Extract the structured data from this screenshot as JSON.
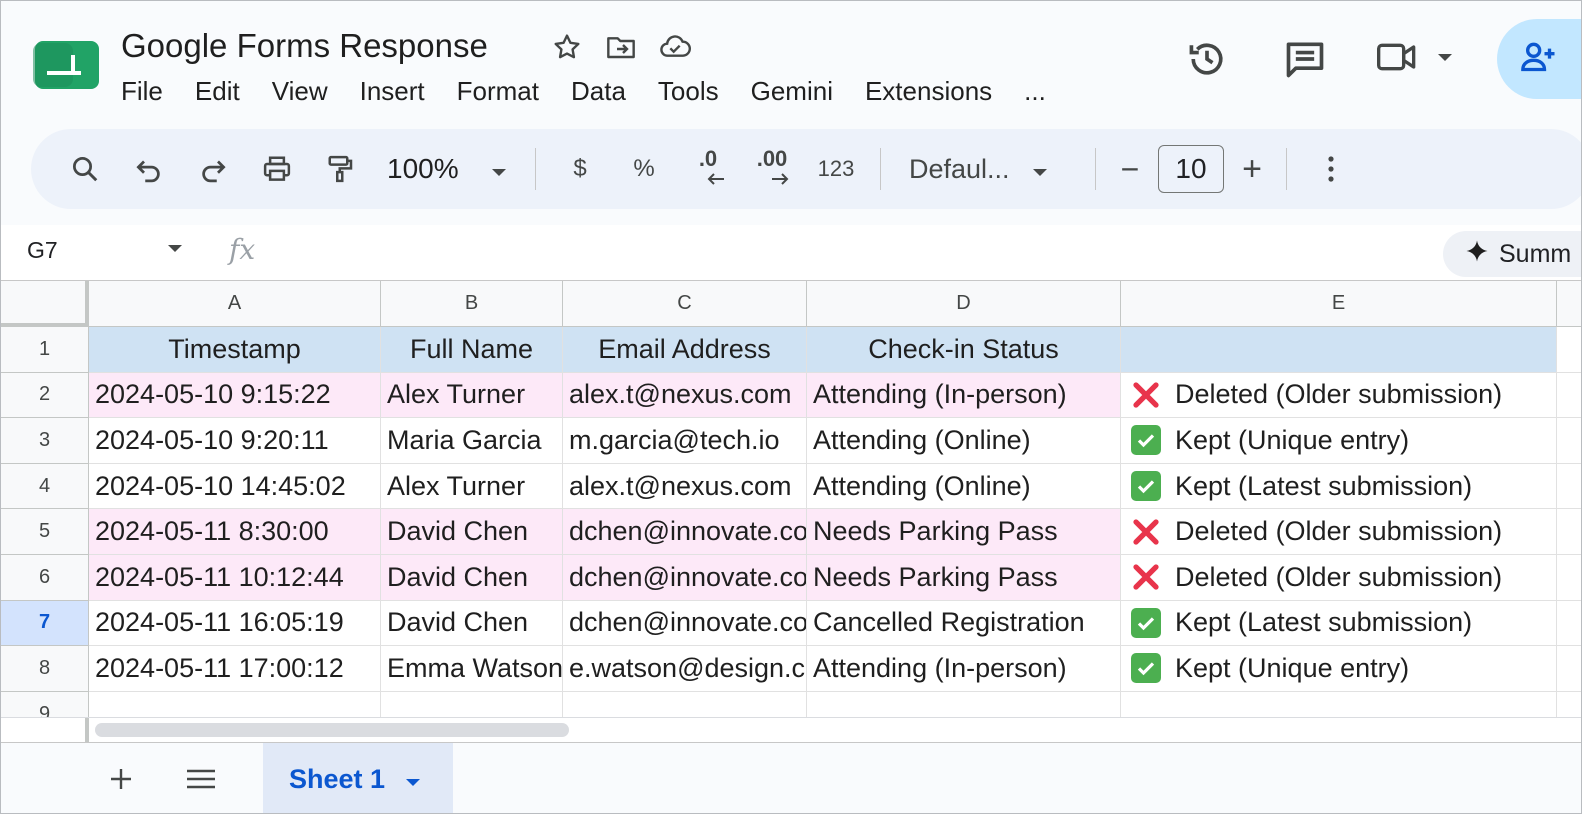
{
  "header": {
    "doc_title": "Google Forms Response",
    "menu": [
      "File",
      "Edit",
      "View",
      "Insert",
      "Format",
      "Data",
      "Tools",
      "Gemini",
      "Extensions",
      "..."
    ]
  },
  "toolbar": {
    "zoom": "100%",
    "currency": "$",
    "percent": "%",
    "dec_decrease": ".0",
    "dec_increase": ".00",
    "number_format": "123",
    "font": "Defaul...",
    "font_size": "10",
    "minus": "−",
    "plus": "+"
  },
  "formula_bar": {
    "cell_ref": "G7",
    "fx": "fx",
    "summarize_label": "Summ"
  },
  "grid": {
    "columns": [
      "A",
      "B",
      "C",
      "D",
      "E"
    ],
    "rows": [
      {
        "num": "1",
        "cells": [
          "Timestamp",
          "Full Name",
          "Email Address",
          "Check-in Status",
          ""
        ],
        "header": true
      },
      {
        "num": "2",
        "cells": [
          "2024-05-10 9:15:22",
          "Alex Turner",
          "alex.t@nexus.com",
          "Attending (In-person)",
          "Deleted (Older submission)"
        ],
        "status": "deleted"
      },
      {
        "num": "3",
        "cells": [
          "2024-05-10 9:20:11",
          "Maria Garcia",
          "m.garcia@tech.io",
          "Attending (Online)",
          "Kept (Unique entry)"
        ],
        "status": "kept"
      },
      {
        "num": "4",
        "cells": [
          "2024-05-10 14:45:02",
          "Alex Turner",
          "alex.t@nexus.com",
          "Attending (Online)",
          "Kept (Latest submission)"
        ],
        "status": "kept"
      },
      {
        "num": "5",
        "cells": [
          "2024-05-11 8:30:00",
          "David Chen",
          "dchen@innovate.co",
          "Needs Parking Pass",
          "Deleted (Older submission)"
        ],
        "status": "deleted"
      },
      {
        "num": "6",
        "cells": [
          "2024-05-11 10:12:44",
          "David Chen",
          "dchen@innovate.co",
          "Needs Parking Pass",
          "Deleted (Older submission)"
        ],
        "status": "deleted"
      },
      {
        "num": "7",
        "cells": [
          "2024-05-11 16:05:19",
          "David Chen",
          "dchen@innovate.co",
          "Cancelled Registration",
          "Kept (Latest submission)"
        ],
        "status": "kept",
        "selected": true
      },
      {
        "num": "8",
        "cells": [
          "2024-05-11 17:00:12",
          "Emma Watson",
          "e.watson@design.co",
          "Attending (In-person)",
          "Kept (Unique entry)"
        ],
        "status": "kept"
      },
      {
        "num": "9",
        "cells": [
          "",
          "",
          "",
          "",
          ""
        ],
        "status": "empty"
      }
    ]
  },
  "sheets": {
    "active_tab": "Sheet 1"
  },
  "colors": {
    "header_fill": "#cfe2f3",
    "deleted_fill": "#fde9f8",
    "deleted_mark": "#e8344b",
    "kept_mark": "#4caf50",
    "accent": "#0b57d0"
  },
  "icons": {
    "deleted": "cross-mark-icon",
    "kept": "check-box-icon"
  }
}
